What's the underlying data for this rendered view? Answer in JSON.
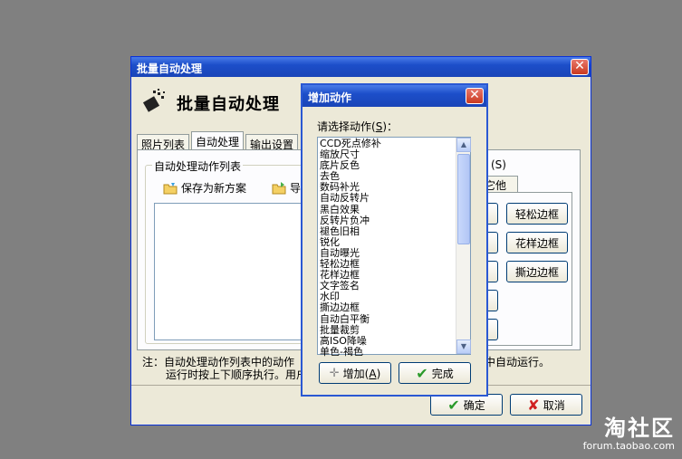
{
  "main_dialog": {
    "title": "批量自动处理",
    "header_title": "批量自动处理",
    "tabs": [
      "照片列表",
      "自动处理",
      "输出设置"
    ],
    "group_title": "自动处理动作列表",
    "save_scheme_label": "保存为新方案",
    "import_label": "导",
    "right_group_title_fragment": "(S)",
    "right_tab_fragment": "它他",
    "frame_buttons": [
      "轻松边框",
      "花样边框",
      "撕边边框"
    ],
    "note_line1": "注：自动处理动作列表中的动作",
    "note_line1_tail": "中自动运行。",
    "note_line2": "运行时按上下顺序执行。用户",
    "ok_label": "确定",
    "cancel_label": "取消"
  },
  "add_dialog": {
    "title": "增加动作",
    "prompt": "请选择动作",
    "prompt_key": "S",
    "actions": [
      "CCD死点修补",
      "缩放尺寸",
      "底片反色",
      "去色",
      "数码补光",
      "自动反转片",
      "黑白效果",
      "反转片负冲",
      "褪色旧相",
      "锐化",
      "自动曝光",
      "轻松边框",
      "花样边框",
      "文字签名",
      "水印",
      "撕边边框",
      "自动白平衡",
      "批量裁剪",
      "高ISO降噪",
      "单色-褐色"
    ],
    "add_label": "增加",
    "add_key": "A",
    "done_label": "完成"
  },
  "watermark": {
    "brand": "淘社区",
    "url": "forum.taobao.com"
  }
}
